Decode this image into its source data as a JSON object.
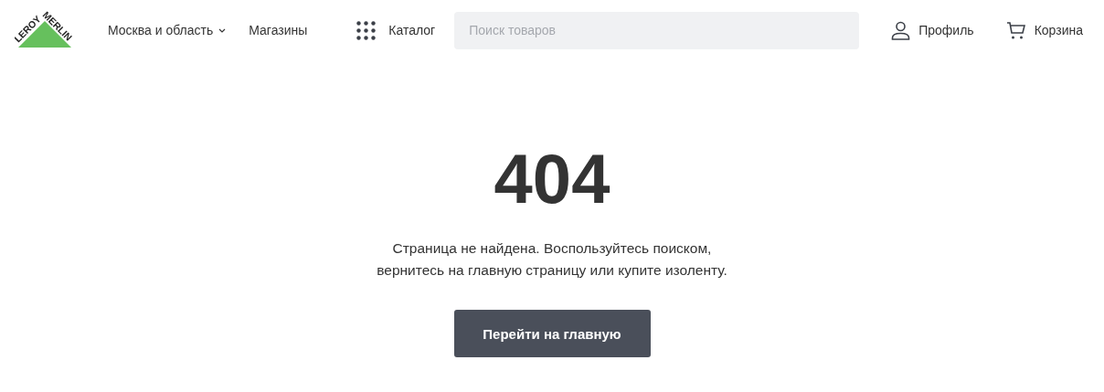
{
  "header": {
    "logo": {
      "word_1": "LEROY",
      "word_2": "MERLIN"
    },
    "region": "Москва и область",
    "stores": "Магазины",
    "catalog": "Каталог",
    "search": {
      "placeholder": "Поиск товаров"
    },
    "profile": "Профиль",
    "cart": "Корзина"
  },
  "error": {
    "code": "404",
    "message_lines": [
      "Страница не найдена. Воспользуйтесь поиском,",
      "вернитесь на главную страницу или купите изоленту."
    ],
    "button": "Перейти на главную"
  }
}
